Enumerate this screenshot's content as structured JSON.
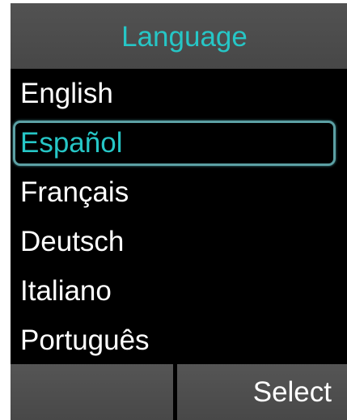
{
  "header": {
    "title": "Language"
  },
  "languages": {
    "items": [
      {
        "label": "English"
      },
      {
        "label": "Español"
      },
      {
        "label": "Français"
      },
      {
        "label": "Deutsch"
      },
      {
        "label": "Italiano"
      },
      {
        "label": "Português"
      }
    ],
    "selected_index": 1
  },
  "softkeys": {
    "left_label": "",
    "right_label": "Select"
  },
  "colors": {
    "accent": "#26c6c6",
    "highlight_border": "#5ca0a4",
    "background": "#000000",
    "bar": "#4d4d4d"
  }
}
